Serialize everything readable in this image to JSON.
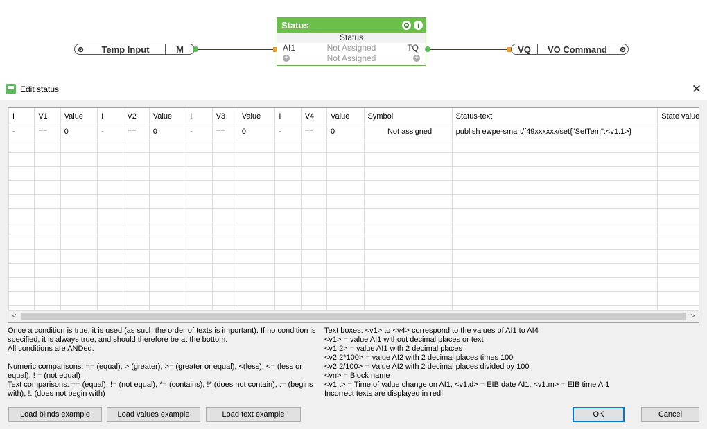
{
  "diagram": {
    "input_block": {
      "label": "Temp Input",
      "output": "M"
    },
    "status_block": {
      "title": "Status",
      "subtitle": "Status",
      "gear_icon": "gear-icon",
      "info_icon": "info-icon",
      "info_glyph": "i",
      "input_label": "AI1",
      "input_value": "Not Assigned",
      "output_label": "TQ",
      "extra_value": "Not Assigned",
      "plus_glyph": "+"
    },
    "output_block": {
      "input": "VQ",
      "label": "VO Command"
    },
    "colors": {
      "accent": "#6cc04a",
      "wire": "#8b1a1a",
      "port_in": "#f0a030",
      "port_out": "#5cb85c"
    }
  },
  "dialog": {
    "title": "Edit status",
    "close_glyph": "✕",
    "table": {
      "columns": [
        "I",
        "V1",
        "Value",
        "I",
        "V2",
        "Value",
        "I",
        "V3",
        "Value",
        "I",
        "V4",
        "Value",
        "Symbol",
        "Status-text",
        "State value"
      ],
      "rows": [
        [
          "-",
          "==",
          "0",
          "-",
          "==",
          "0",
          "-",
          "==",
          "0",
          "-",
          "==",
          "0",
          "Not assigned",
          "publish ewpe-smart/f49xxxxxx/set{\"SetTem\":<v1.1>}",
          ""
        ]
      ]
    },
    "scroll": {
      "left_glyph": "<",
      "right_glyph": ">"
    },
    "help_left": [
      "Once a condition is true, it is used (as such the order of texts is important). If no condition is specified, it is always true, and should therefore be at the bottom.",
      "All conditions are ANDed.",
      "",
      "Numeric comparisons: == (equal), > (greater), >= (greater or equal), <(less), <= (less or equal), ! = (not equal)",
      "Text comparisons: == (equal), != (not equal), *= (contains), !* (does not contain), := (begins with), !: (does not begin with)"
    ],
    "help_right": [
      "Text boxes: <v1> to <v4> correspond to the values of AI1 to AI4",
      "<v1> = value AI1 without decimal places or text",
      "<v1.2> = value AI1 with 2 decimal places",
      "<v2.2*100> = value AI2 with 2 decimal places times 100",
      "<v2.2/100> = Value AI2 with 2 decimal places divided by 100",
      "<vn> = Block name",
      "<v1.t> = Time of value change on AI1, <v1.d> = EIB date AI1, <v1.m> = EIB time AI1",
      "Incorrect texts are displayed in red!"
    ],
    "buttons": {
      "load_blinds": "Load blinds example",
      "load_values": "Load values example",
      "load_text": "Load text example",
      "ok": "OK",
      "cancel": "Cancel"
    }
  }
}
